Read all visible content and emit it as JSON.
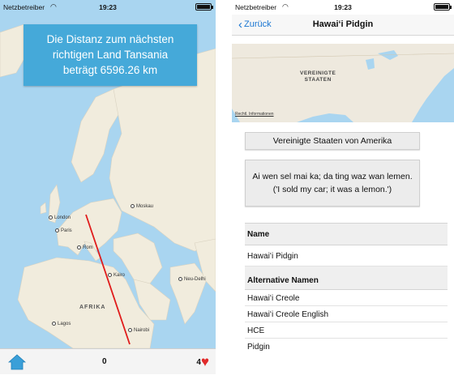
{
  "left_screen": {
    "status": {
      "carrier": "Netzbetreiber",
      "time": "19:23"
    },
    "info_box": {
      "line1": "Die Distanz zum nächsten",
      "line2": "richtigen Land Tansania",
      "line3": "beträgt 6596.26 km"
    },
    "map": {
      "region_label": "AFRIKA",
      "cities": [
        "London",
        "Paris",
        "Rom",
        "Moskau",
        "Kairo",
        "Neu-Delhi",
        "Lagos",
        "Nairobi"
      ]
    },
    "colors": {
      "sea": "#a9d5f0",
      "land": "#f1ecdd",
      "line": "#e01b1b",
      "box": "#45a9d9"
    },
    "bottom_bar": {
      "home_icon": "home-icon",
      "score": "0",
      "lives": "4",
      "heart_icon": "heart-icon"
    }
  },
  "right_screen": {
    "status": {
      "carrier": "Netzbetreiber",
      "time": "19:23"
    },
    "nav": {
      "back_label": "Zurück",
      "title": "Hawaiʻi Pidgin"
    },
    "map": {
      "country_label_1": "VEREINIGTE",
      "country_label_2": "STAATEN",
      "legal": "Rechtl. Informationen"
    },
    "country_button": "Vereinigte Staaten von Amerika",
    "example": {
      "line1": "Ai wen sel mai ka; da ting waz wan lemen.",
      "line2": "('I sold my car; it was a lemon.')"
    },
    "table": {
      "name_header": "Name",
      "name_value": "Hawaiʻi Pidgin",
      "alt_header": "Alternative Namen",
      "alt_names": [
        "Hawaiʻi Creole",
        "Hawaiʻi Creole English",
        "HCE",
        "Pidgin"
      ]
    }
  }
}
